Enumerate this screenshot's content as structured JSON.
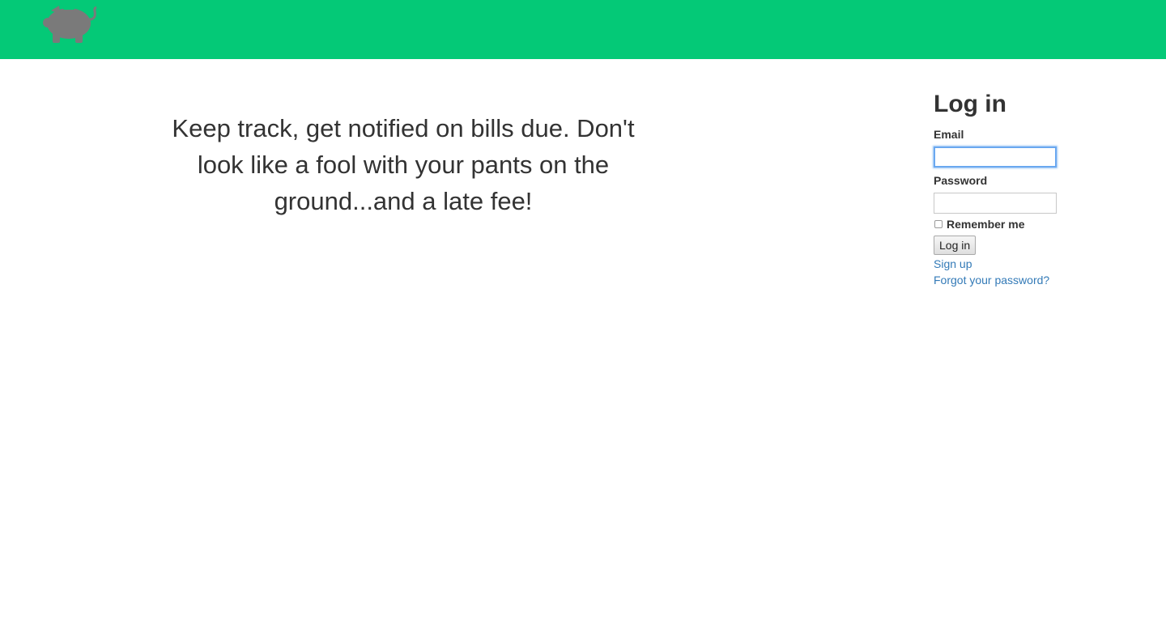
{
  "header": {
    "logo_icon": "piggy-bank-icon",
    "logo_color": "#7a7a7a",
    "background_color": "#04c977"
  },
  "main": {
    "tagline": "Keep track, get notified on bills due. Don't look like a fool with your pants on the ground...and a late fee!"
  },
  "login": {
    "title": "Log in",
    "email_label": "Email",
    "email_value": "",
    "password_label": "Password",
    "password_value": "",
    "remember_label": "Remember me",
    "remember_checked": false,
    "submit_label": "Log in",
    "signup_link": "Sign up",
    "forgot_link": "Forgot your password?",
    "link_color": "#337ab7"
  }
}
